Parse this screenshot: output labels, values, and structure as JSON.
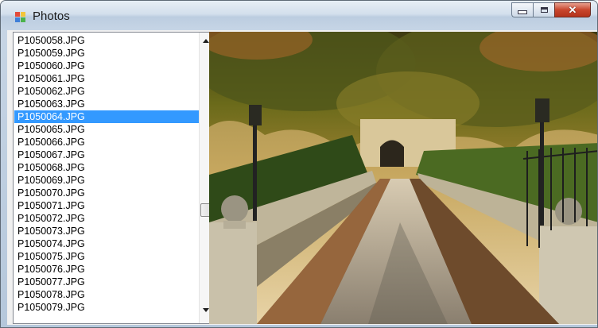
{
  "window": {
    "title": "Photos",
    "colors": {
      "accent": "#3399ff",
      "titlebar": "#d3dfec",
      "close": "#c8452c"
    }
  },
  "caption_buttons": {
    "minimize_icon": "minimize-icon",
    "maximize_icon": "maximize-icon",
    "close_icon": "close-icon",
    "close_glyph": "✕"
  },
  "file_list": {
    "selected_index": 6,
    "items": [
      "P1050058.JPG",
      "P1050059.JPG",
      "P1050060.JPG",
      "P1050061.JPG",
      "P1050062.JPG",
      "P1050063.JPG",
      "P1050064.JPG",
      "P1050065.JPG",
      "P1050066.JPG",
      "P1050067.JPG",
      "P1050068.JPG",
      "P1050069.JPG",
      "P1050070.JPG",
      "P1050071.JPG",
      "P1050072.JPG",
      "P1050073.JPG",
      "P1050074.JPG",
      "P1050075.JPG",
      "P1050076.JPG",
      "P1050077.JPG",
      "P1050078.JPG",
      "P1050079.JPG"
    ],
    "scroll_position": 0.62
  },
  "preview": {
    "description_icon": "photo-preview"
  }
}
